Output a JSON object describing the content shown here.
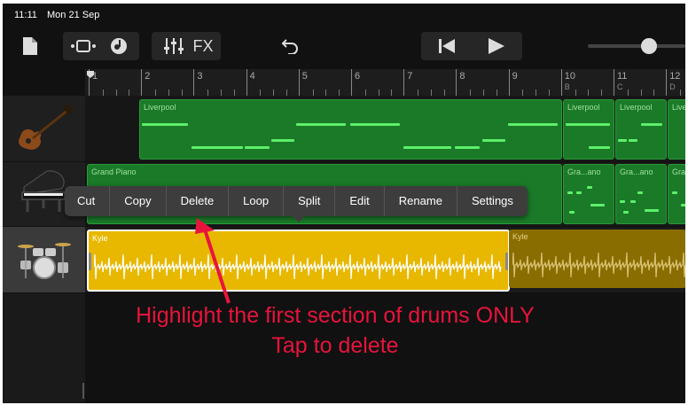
{
  "status": {
    "time": "11:11",
    "date": "Mon 21 Sep"
  },
  "toolbar": {
    "fx_label": "FX"
  },
  "ruler": {
    "bars": [
      {
        "n": "1",
        "sub": ""
      },
      {
        "n": "2",
        "sub": ""
      },
      {
        "n": "3",
        "sub": ""
      },
      {
        "n": "4",
        "sub": ""
      },
      {
        "n": "5",
        "sub": ""
      },
      {
        "n": "6",
        "sub": ""
      },
      {
        "n": "7",
        "sub": ""
      },
      {
        "n": "8",
        "sub": ""
      },
      {
        "n": "9",
        "sub": ""
      },
      {
        "n": "10",
        "sub": "B"
      },
      {
        "n": "11",
        "sub": "C"
      },
      {
        "n": "12",
        "sub": "D"
      }
    ]
  },
  "tracks": {
    "bass": {
      "region_main": "Liverpool",
      "region_2": "Liverpool",
      "region_3": "Liverpool",
      "region_4": "Liverpool"
    },
    "piano": {
      "region_main": "Grand Piano",
      "region_2": "Gra...ano",
      "region_3": "Gra...ano",
      "region_4": "Gra"
    },
    "drums": {
      "region_selected": "Kyle",
      "region_2": "Kyle"
    }
  },
  "context_menu": [
    "Cut",
    "Copy",
    "Delete",
    "Loop",
    "Split",
    "Edit",
    "Rename",
    "Settings"
  ],
  "annotation": {
    "line1": "Highlight the first section of drums ONLY",
    "line2": "Tap to delete",
    "color": "#e8143c"
  },
  "colors": {
    "bass_region": "#1a7a28",
    "drum_selected": "#e8b800",
    "drum_region": "#8a6d00"
  }
}
